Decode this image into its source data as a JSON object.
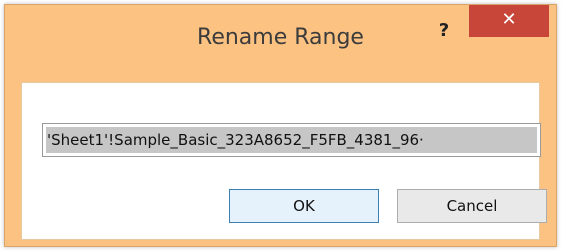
{
  "dialog": {
    "title": "Rename Range",
    "help_label": "?",
    "close_label": "✕"
  },
  "name_field": {
    "value": "'Sheet1'!Sample_Basic_323A8652_F5FB_4381_96·"
  },
  "buttons": {
    "ok_label": "OK",
    "cancel_label": "Cancel"
  },
  "colors": {
    "frame": "#fbc282",
    "close": "#c8453a",
    "selection": "#c6c6c6"
  }
}
